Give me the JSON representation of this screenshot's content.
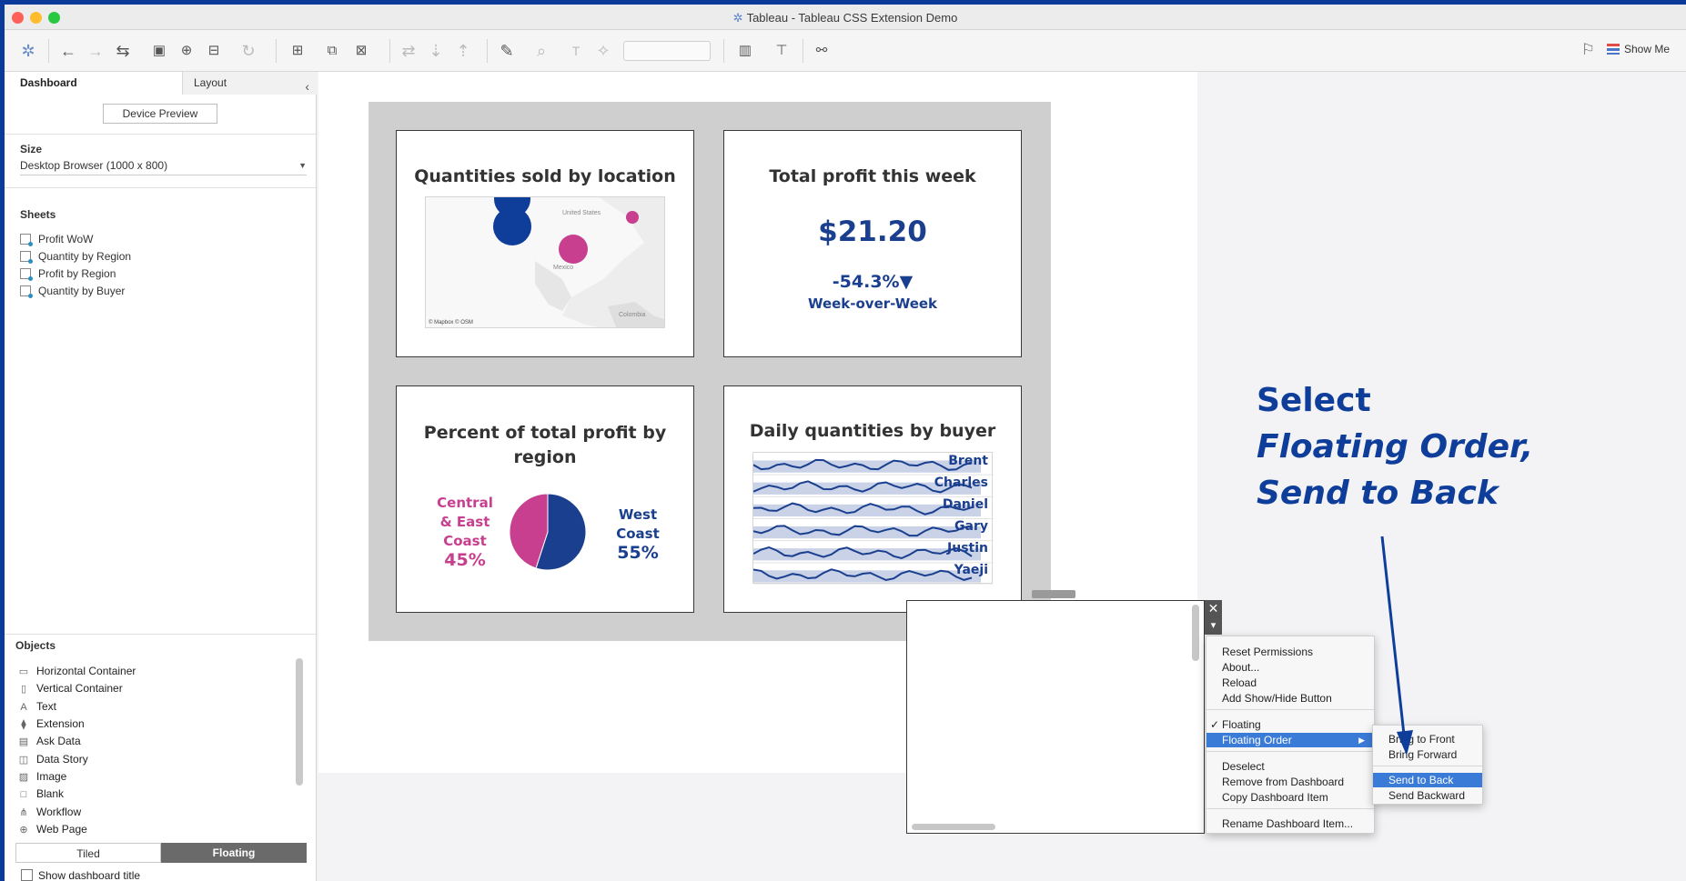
{
  "window": {
    "title": "Tableau - Tableau CSS Extension Demo",
    "colors": {
      "frame": "#0a3a9a",
      "navy": "#1a3f8f",
      "magenta": "#c73f8e",
      "highlight": "#3b7bd8"
    }
  },
  "toolbar": {
    "icons": [
      "tableau-logo-icon",
      "undo-icon",
      "redo-icon",
      "replay-icon",
      "save-icon",
      "new-datasource-icon",
      "pause-icon",
      "refresh-icon",
      "new-sheet-icon",
      "duplicate-icon",
      "clear-icon",
      "swap-icon",
      "sort-asc-icon",
      "sort-desc-icon",
      "highlight-icon",
      "group-icon",
      "label-icon",
      "pin-icon",
      "fit-dropdown",
      "show-cards-icon",
      "presentation-icon",
      "share-icon"
    ],
    "show_me": "Show Me"
  },
  "sidebar": {
    "tabs": {
      "dashboard": "Dashboard",
      "layout": "Layout"
    },
    "device_preview": "Device Preview",
    "size": {
      "title": "Size",
      "value": "Desktop Browser (1000 x 800)"
    },
    "sheets": {
      "title": "Sheets",
      "items": [
        "Profit WoW",
        "Quantity by Region",
        "Profit by Region",
        "Quantity by Buyer"
      ]
    },
    "objects": {
      "title": "Objects",
      "items": [
        {
          "label": "Horizontal Container",
          "icon": "horizontal-container-icon"
        },
        {
          "label": "Vertical Container",
          "icon": "vertical-container-icon"
        },
        {
          "label": "Text",
          "icon": "text-icon"
        },
        {
          "label": "Extension",
          "icon": "extension-icon"
        },
        {
          "label": "Ask Data",
          "icon": "ask-data-icon"
        },
        {
          "label": "Data Story",
          "icon": "data-story-icon"
        },
        {
          "label": "Image",
          "icon": "image-icon"
        },
        {
          "label": "Blank",
          "icon": "blank-icon"
        },
        {
          "label": "Workflow",
          "icon": "workflow-icon"
        },
        {
          "label": "Web Page",
          "icon": "web-page-icon"
        }
      ]
    },
    "layout_mode": {
      "tiled": "Tiled",
      "floating": "Floating",
      "selected": "Floating"
    },
    "show_dashboard_title": "Show dashboard title"
  },
  "dashboard": {
    "map": {
      "title": "Quantities sold by location",
      "credit": "© Mapbox © OSM",
      "labels": [
        "United States",
        "Mexico",
        "Colombia"
      ]
    },
    "profit": {
      "title": "Total profit this week",
      "value": "$21.20",
      "change": "-54.3%▼",
      "caption": "Week-over-Week"
    },
    "pie": {
      "title_line1": "Percent of total profit by",
      "title_line2": "region",
      "left_label": [
        "Central",
        "& East",
        "Coast"
      ],
      "left_pct": "45%",
      "right_label": [
        "West",
        "Coast"
      ],
      "right_pct": "55%"
    },
    "buyers": {
      "title": "Daily quantities by buyer",
      "names": [
        "Brent",
        "Charles",
        "Daniel",
        "Gary",
        "Justin",
        "Yaeji"
      ]
    }
  },
  "chart_data": [
    {
      "type": "pie",
      "categories": [
        "Central & East Coast",
        "West Coast"
      ],
      "values": [
        45,
        55
      ],
      "title": "Percent of total profit by region"
    }
  ],
  "extension": {
    "close": "✕",
    "menu": "▾"
  },
  "context_menu": {
    "items": [
      "Reset Permissions",
      "About...",
      "Reload",
      "Add Show/Hide Button",
      "Floating",
      "Floating Order",
      "Deselect",
      "Remove from Dashboard",
      "Copy Dashboard Item",
      "Rename Dashboard Item..."
    ],
    "checked": "✓",
    "submenu_arrow": "▶",
    "floating_order": [
      "Bring to Front",
      "Bring Forward",
      "Send to Back",
      "Send Backward"
    ]
  },
  "annotation": {
    "line1": "Select",
    "line2": "Floating Order,",
    "line3": "Send to Back"
  }
}
